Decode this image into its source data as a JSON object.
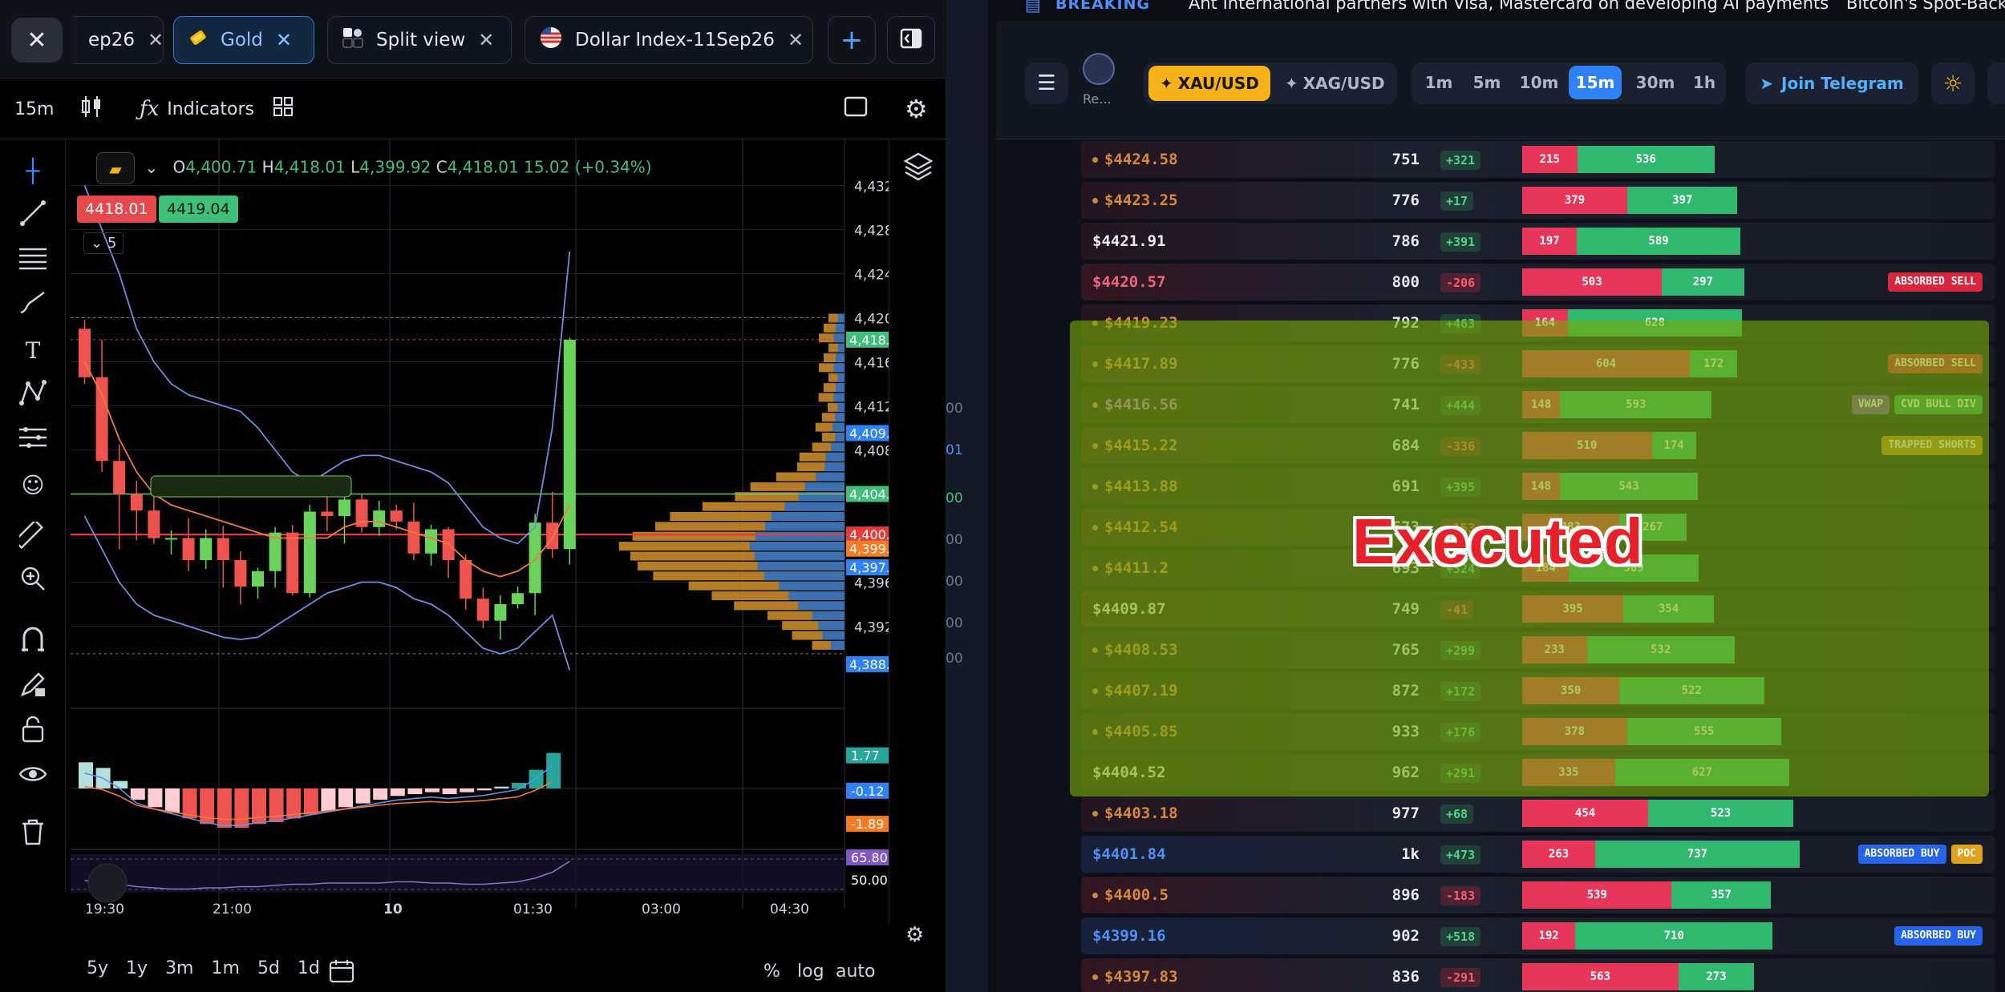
{
  "tabs": {
    "items": [
      {
        "label": "ep26"
      },
      {
        "label": "Gold"
      },
      {
        "label": "Split view"
      },
      {
        "label": "Dollar Index-11Sep26"
      }
    ]
  },
  "toolbar": {
    "interval": "15m",
    "indicators": "Indicators"
  },
  "ohlc": {
    "o_label": "O",
    "o": "4,400.71",
    "h_label": "H",
    "h": "4,418.01",
    "l_label": "L",
    "l": "4,399.92",
    "c_label": "C",
    "c": "4,418.01",
    "chg": "15.02 (+0.34%)"
  },
  "quote": {
    "bid": "4418.01",
    "ask": "4419.04",
    "count": "5"
  },
  "chart_data": {
    "type": "candlestick",
    "price_axis": [
      "4,432.00",
      "4,428.00",
      "4,424.00",
      "4,420.00",
      "4,416.00",
      "4,412.00",
      "4,408.00",
      "4,404.00",
      "4,400.00",
      "4,396.00",
      "4,392.00"
    ],
    "price_range": [
      4386,
      4434
    ],
    "price_tags": [
      {
        "label": "4,418.01",
        "price": 4418.01,
        "color": "#3ec07a"
      },
      {
        "label": "4,409.53",
        "price": 4409.53,
        "color": "#2f82f5"
      },
      {
        "label": "4,404.00",
        "price": 4404.0,
        "color": "#3ec07a"
      },
      {
        "label": "4,400.32",
        "price": 4400.32,
        "color": "#e63b3b"
      },
      {
        "label": "4,399.04",
        "price": 4399.04,
        "color": "#f57c23"
      },
      {
        "label": "4,397.34",
        "price": 4397.34,
        "color": "#2f82f5"
      },
      {
        "label": "4,388.55",
        "price": 4388.55,
        "color": "#2f82f5"
      }
    ],
    "time_axis": [
      "19:30",
      "21:00",
      "10",
      "01:30",
      "03:00",
      "04:30"
    ],
    "candles": [
      [
        4419.0,
        4419.8,
        4414.0,
        4414.6
      ],
      [
        4414.6,
        4418.0,
        4406.0,
        4407.0
      ],
      [
        4407.0,
        4408.5,
        4399.0,
        4404.0
      ],
      [
        4404.0,
        4405.2,
        4399.8,
        4402.5
      ],
      [
        4402.5,
        4404.6,
        4399.5,
        4400.0
      ],
      [
        4400.0,
        4400.7,
        4398.5,
        4400.0
      ],
      [
        4400.0,
        4401.8,
        4397.0,
        4398.0
      ],
      [
        4398.0,
        4400.8,
        4397.2,
        4400.0
      ],
      [
        4400.0,
        4401.1,
        4395.5,
        4398.0
      ],
      [
        4398.0,
        4398.8,
        4394.0,
        4395.6
      ],
      [
        4395.6,
        4397.3,
        4394.5,
        4397.0
      ],
      [
        4397.0,
        4401.0,
        4395.5,
        4400.5
      ],
      [
        4400.5,
        4401.2,
        4394.8,
        4395.0
      ],
      [
        4395.0,
        4403.0,
        4394.6,
        4402.4
      ],
      [
        4402.4,
        4404.0,
        4400.6,
        4402.0
      ],
      [
        4402.0,
        4404.3,
        4399.5,
        4403.5
      ],
      [
        4403.5,
        4404.0,
        4400.5,
        4401.0
      ],
      [
        4401.0,
        4403.4,
        4400.2,
        4402.5
      ],
      [
        4402.5,
        4403.0,
        4400.8,
        4401.5
      ],
      [
        4401.5,
        4403.2,
        4398.0,
        4398.6
      ],
      [
        4398.6,
        4401.2,
        4397.5,
        4400.8
      ],
      [
        4400.8,
        4401.0,
        4396.4,
        4398.0
      ],
      [
        4398.0,
        4398.5,
        4393.5,
        4394.5
      ],
      [
        4394.5,
        4395.5,
        4391.8,
        4392.5
      ],
      [
        4392.5,
        4394.8,
        4390.8,
        4394.0
      ],
      [
        4394.0,
        4395.6,
        4393.6,
        4395.0
      ],
      [
        4395.0,
        4402.2,
        4393.0,
        4401.4
      ],
      [
        4401.4,
        4404.2,
        4398.2,
        4399.0
      ],
      [
        4399.0,
        4418.2,
        4397.6,
        4418.0
      ]
    ],
    "histogram": [
      1.4,
      1.1,
      0.4,
      -0.6,
      -1.0,
      -1.3,
      -1.6,
      -1.9,
      -2.1,
      -2.1,
      -1.9,
      -1.8,
      -1.6,
      -1.4,
      -1.2,
      -1.0,
      -0.8,
      -0.6,
      -0.4,
      -0.3,
      -0.2,
      -0.3,
      -0.2,
      -0.1,
      0.1,
      0.3,
      1.0,
      1.9
    ],
    "histogram_range": [
      -3.0,
      3.0
    ],
    "osc_tags": [
      {
        "label": "1.77",
        "value": 1.77,
        "color": "#26a69a"
      },
      {
        "label": "-0.12",
        "value": -0.12,
        "color": "#2f82f5"
      },
      {
        "label": "-1.89",
        "value": -1.89,
        "color": "#f57c23"
      }
    ],
    "rsi_tags": [
      {
        "label": "65.80",
        "color": "#7e57c2"
      },
      {
        "label": "50.00",
        "color": "#000000"
      }
    ]
  },
  "bottom": {
    "ranges": [
      "5y",
      "1y",
      "3m",
      "1m",
      "5d",
      "1d"
    ],
    "pct": "%",
    "log": "log",
    "auto": "auto"
  },
  "ticker": {
    "label": "BREAKING",
    "headline1": "Ant International partners with Visa, Mastercard on developing AI payments",
    "headline2": "Bitcoin's Spot-Back"
  },
  "header": {
    "brand_small": "Re...",
    "pair1": "XAU/USD",
    "pair2": "XAG/USD",
    "timeframes": [
      "1m",
      "5m",
      "10m",
      "15m",
      "30m",
      "1h"
    ],
    "active_tf": "15m",
    "telegram": "Join Telegram",
    "side_numbers": [
      "00",
      "01",
      "00",
      "00",
      "00",
      "00",
      "00"
    ]
  },
  "overlay_text": "Executed",
  "rows": [
    {
      "price": "$4424.58",
      "dot": true,
      "pcolor": "#d8883a",
      "vol": "751",
      "delta": "+321",
      "sell": 215,
      "buy": 536,
      "badges": []
    },
    {
      "price": "$4423.25",
      "dot": true,
      "pcolor": "#d8883a",
      "vol": "776",
      "delta": "+17",
      "sell": 379,
      "buy": 397,
      "badges": []
    },
    {
      "price": "$4421.91",
      "dot": false,
      "pcolor": "#e8eaef",
      "vol": "786",
      "delta": "+391",
      "sell": 197,
      "buy": 589,
      "badges": []
    },
    {
      "price": "$4420.57",
      "dot": false,
      "pcolor": "#f0637a",
      "vol": "800",
      "delta": "-206",
      "sell": 503,
      "buy": 297,
      "badges": [
        {
          "t": "ABSORBED SELL",
          "c": "#d8263f"
        }
      ]
    },
    {
      "price": "$4419.23",
      "dot": true,
      "pcolor": "#d8883a",
      "vol": "792",
      "delta": "+463",
      "sell": 164,
      "buy": 628,
      "badges": []
    },
    {
      "price": "$4417.89",
      "dot": true,
      "pcolor": "#d8883a",
      "vol": "776",
      "delta": "-433",
      "sell": 604,
      "buy": 172,
      "badges": [
        {
          "t": "ABSORBED SELL",
          "c": "#d8263f"
        }
      ]
    },
    {
      "price": "$4416.56",
      "dot": true,
      "pcolor": "#c96fd8",
      "vol": "741",
      "delta": "+444",
      "sell": 148,
      "buy": 593,
      "badges": [
        {
          "t": "VWAP",
          "c": "#7a3fb0"
        },
        {
          "t": "CVD BULL DIV",
          "c": "#2f9e5c"
        }
      ]
    },
    {
      "price": "$4415.22",
      "dot": true,
      "pcolor": "#d8883a",
      "vol": "684",
      "delta": "-336",
      "sell": 510,
      "buy": 174,
      "badges": [
        {
          "t": "TRAPPED SHORTS",
          "c": "#c9801f"
        }
      ]
    },
    {
      "price": "$4413.88",
      "dot": true,
      "pcolor": "#d8883a",
      "vol": "691",
      "delta": "+395",
      "sell": 148,
      "buy": 543,
      "badges": []
    },
    {
      "price": "$4412.54",
      "dot": true,
      "pcolor": "#d8883a",
      "vol": "673",
      "delta": "-153",
      "sell": 383,
      "buy": 267,
      "badges": []
    },
    {
      "price": "$4411.2",
      "dot": true,
      "pcolor": "#d8883a",
      "vol": "693",
      "delta": "+324",
      "sell": 184,
      "buy": 509,
      "badges": []
    },
    {
      "price": "$4409.87",
      "dot": false,
      "pcolor": "#e8eaef",
      "vol": "749",
      "delta": "-41",
      "sell": 395,
      "buy": 354,
      "badges": []
    },
    {
      "price": "$4408.53",
      "dot": true,
      "pcolor": "#d8883a",
      "vol": "765",
      "delta": "+299",
      "sell": 233,
      "buy": 532,
      "badges": []
    },
    {
      "price": "$4407.19",
      "dot": true,
      "pcolor": "#d8883a",
      "vol": "872",
      "delta": "+172",
      "sell": 350,
      "buy": 522,
      "badges": []
    },
    {
      "price": "$4405.85",
      "dot": true,
      "pcolor": "#d8883a",
      "vol": "933",
      "delta": "+176",
      "sell": 378,
      "buy": 555,
      "badges": []
    },
    {
      "price": "$4404.52",
      "dot": false,
      "pcolor": "#e8eaef",
      "vol": "962",
      "delta": "+291",
      "sell": 335,
      "buy": 627,
      "badges": []
    },
    {
      "price": "$4403.18",
      "dot": true,
      "pcolor": "#d8883a",
      "vol": "977",
      "delta": "+68",
      "sell": 454,
      "buy": 523,
      "badges": []
    },
    {
      "price": "$4401.84",
      "dot": false,
      "pcolor": "#4f8ff7",
      "vol": "1k",
      "delta": "+473",
      "sell": 263,
      "buy": 737,
      "badges": [
        {
          "t": "ABSORBED BUY",
          "c": "#2563eb"
        },
        {
          "t": "POC",
          "c": "#e0a11b"
        }
      ]
    },
    {
      "price": "$4400.5",
      "dot": true,
      "pcolor": "#d8883a",
      "vol": "896",
      "delta": "-183",
      "sell": 539,
      "buy": 357,
      "badges": []
    },
    {
      "price": "$4399.16",
      "dot": false,
      "pcolor": "#4f8ff7",
      "vol": "902",
      "delta": "+518",
      "sell": 192,
      "buy": 710,
      "badges": [
        {
          "t": "ABSORBED BUY",
          "c": "#2563eb"
        }
      ]
    },
    {
      "price": "$4397.83",
      "dot": true,
      "pcolor": "#d8883a",
      "vol": "836",
      "delta": "-291",
      "sell": 563,
      "buy": 273,
      "badges": []
    }
  ]
}
